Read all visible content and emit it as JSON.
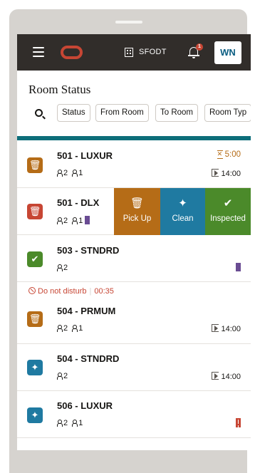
{
  "header": {
    "property_code": "SFODT",
    "notification_count": "1",
    "user_initials": "WN"
  },
  "page": {
    "title": "Room Status"
  },
  "filters": [
    {
      "label": "Status"
    },
    {
      "label": "From Room"
    },
    {
      "label": "To Room"
    },
    {
      "label": "Room Typ"
    }
  ],
  "rooms": [
    {
      "name": "501 - LUXUR",
      "adults": "2",
      "children": "1",
      "timer": "5:00",
      "departure": "14:00",
      "status": "pickup"
    },
    {
      "name": "501 - DLX",
      "adults": "2",
      "children": "1",
      "status": "dirty"
    },
    {
      "name": "503 - STNDRD",
      "adults": "2",
      "status": "inspected"
    },
    {
      "name": "504 - PRMUM",
      "adults": "2",
      "children": "1",
      "departure": "14:00",
      "dnd_label": "Do not disturb",
      "dnd_time": "00:35",
      "status": "pickup"
    },
    {
      "name": "504 - STNDRD",
      "adults": "2",
      "departure": "14:00",
      "status": "clean"
    },
    {
      "name": "506 - LUXUR",
      "adults": "2",
      "children": "1",
      "status": "clean"
    }
  ],
  "swipe_actions": [
    {
      "label": "Pick Up",
      "color": "#b56c17"
    },
    {
      "label": "Clean",
      "color": "#1f7aa1"
    },
    {
      "label": "Inspected",
      "color": "#4b8a2a"
    }
  ],
  "colors": {
    "topbar": "#312d2a",
    "accent_bar": "#0d6e7a",
    "pickup": "#b56c17",
    "dirty": "#c74634",
    "clean": "#1f7aa1",
    "inspected": "#4b8a2a"
  }
}
